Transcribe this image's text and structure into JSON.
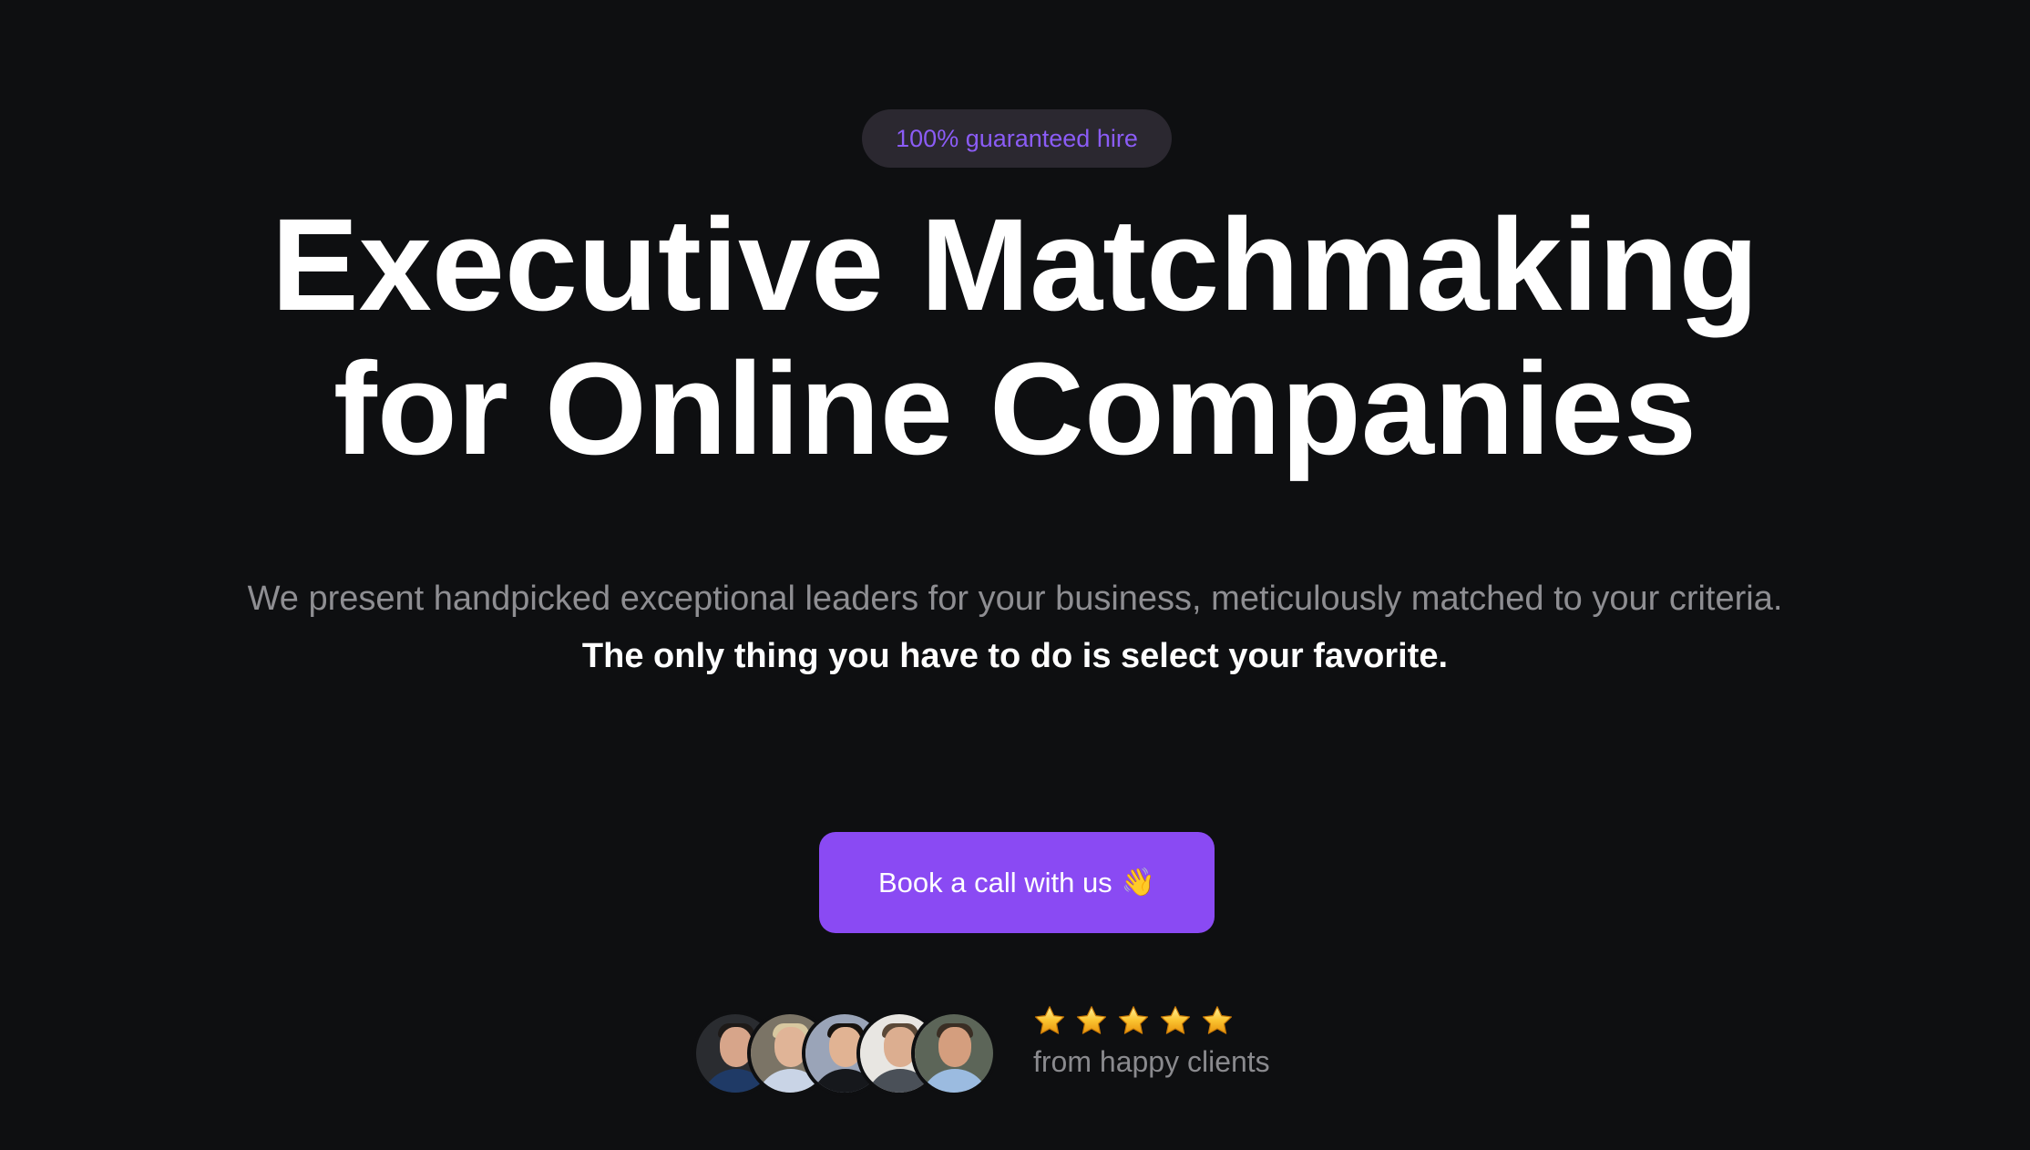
{
  "badge": {
    "label": "100% guaranteed hire"
  },
  "hero": {
    "title_line1": "Executive Matchmaking",
    "title_line2": "for Online Companies",
    "subtitle_regular": "We present handpicked exceptional leaders for your business, meticulously matched to your criteria.",
    "subtitle_bold": "The only thing you have to do is select your favorite."
  },
  "cta": {
    "label": "Book a call with us",
    "emoji": "👋"
  },
  "social_proof": {
    "avatars": [
      {
        "name": "client-avatar-1"
      },
      {
        "name": "client-avatar-2"
      },
      {
        "name": "client-avatar-3"
      },
      {
        "name": "client-avatar-4"
      },
      {
        "name": "client-avatar-5"
      }
    ],
    "rating": {
      "stars": 5,
      "max": 5,
      "icon": "star-icon"
    },
    "text": "from happy clients"
  },
  "colors": {
    "background": "#0e0f11",
    "accent": "#8a4af3",
    "badge_text": "#8b5cf6",
    "badge_bg": "#2b2830",
    "muted_text": "#8e8e92",
    "star": "#fbbf24"
  }
}
